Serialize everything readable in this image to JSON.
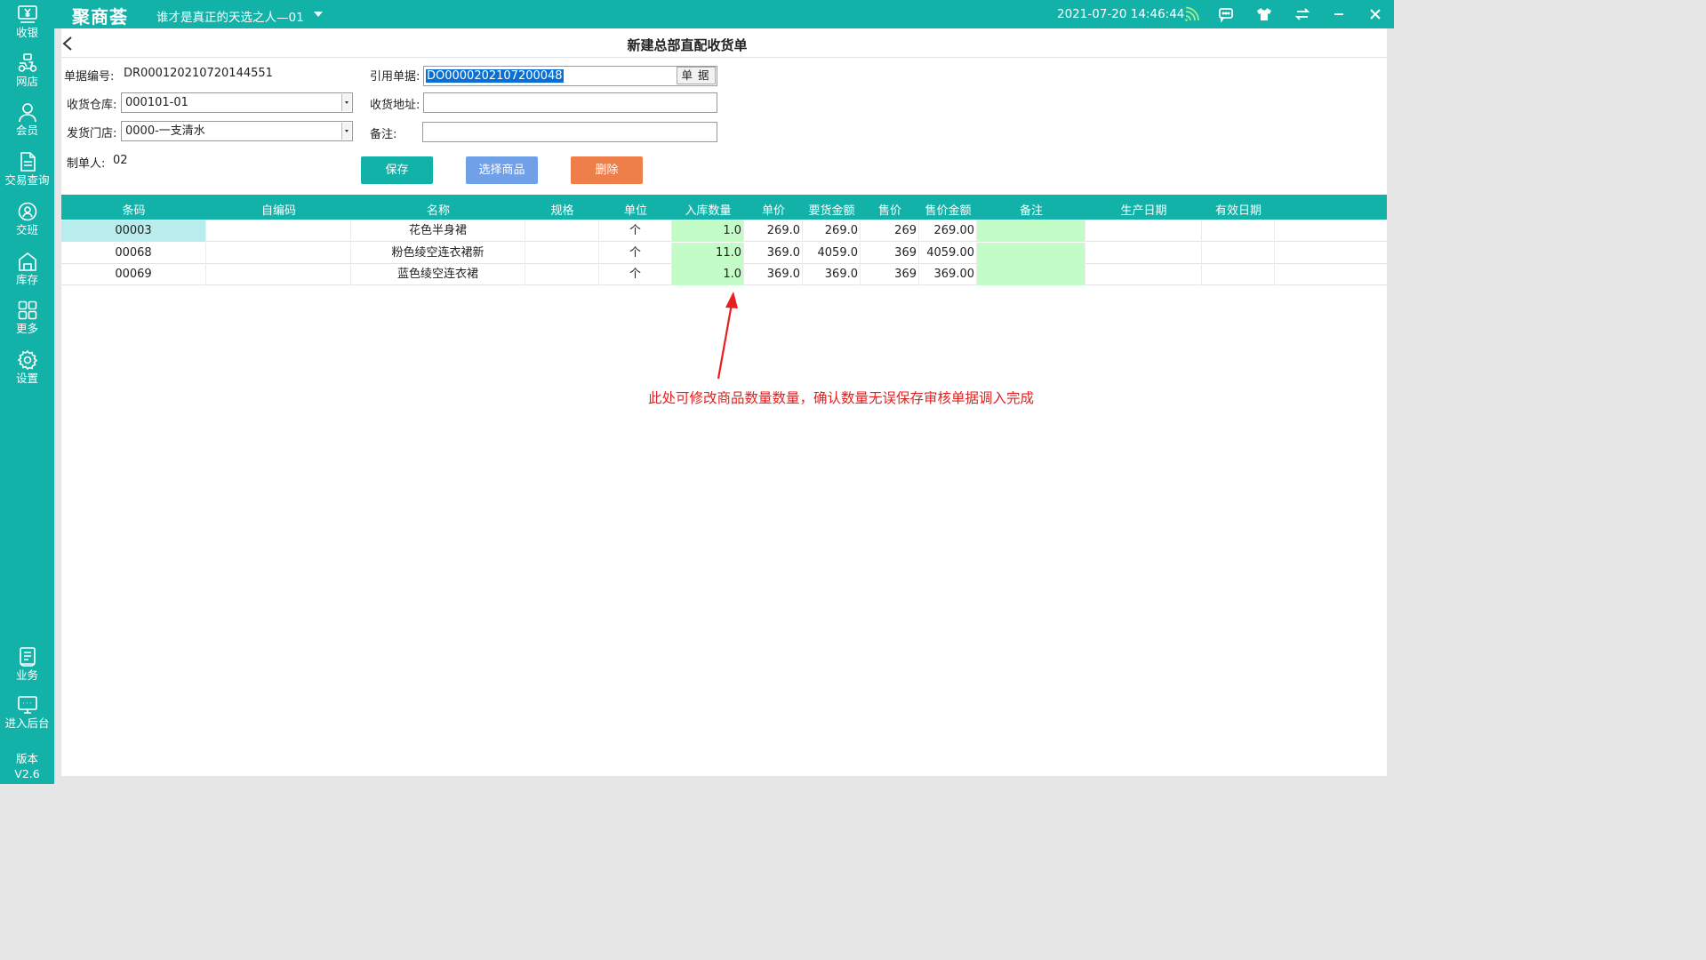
{
  "sidebar": {
    "items": [
      {
        "label": "收银",
        "icon": "cash-register-icon"
      },
      {
        "label": "网店",
        "icon": "delivery-scooter-icon"
      },
      {
        "label": "会员",
        "icon": "member-icon"
      },
      {
        "label": "交易查询",
        "icon": "transaction-query-icon"
      },
      {
        "label": "交班",
        "icon": "shift-handover-icon"
      },
      {
        "label": "库存",
        "icon": "inventory-icon"
      },
      {
        "label": "更多",
        "icon": "more-grid-icon"
      },
      {
        "label": "设置",
        "icon": "settings-gear-icon"
      },
      {
        "label": "业务",
        "icon": "business-icon"
      },
      {
        "label": "进入后台",
        "icon": "backend-monitor-icon"
      }
    ],
    "version_label": "版本",
    "version_value": "V2.6"
  },
  "topbar": {
    "logo": "聚商荟",
    "store_name": "谁才是真正的天选之人—01",
    "datetime": "2021-07-20 14:46:44",
    "accent_color": "#13b2a8"
  },
  "page": {
    "title": "新建总部直配收货单"
  },
  "form": {
    "doc_no_label": "单据编号:",
    "doc_no_value": "DR000120210720144551",
    "ref_doc_label": "引用单据:",
    "ref_doc_value": "DO0000202107200048",
    "ref_doc_button": "单据",
    "warehouse_label": "收货仓库:",
    "warehouse_value": "000101-01",
    "address_label": "收货地址:",
    "address_value": "",
    "ship_store_label": "发货门店:",
    "ship_store_value": "0000-一支清水",
    "remark_label": "备注:",
    "remark_value": "",
    "creator_label": "制单人:",
    "creator_value": "02"
  },
  "actions": {
    "save": "保存",
    "select_goods": "选择商品",
    "delete": "删除",
    "save_color": "#13b2a8",
    "select_color": "#6fa0e8",
    "delete_color": "#ee7f4a"
  },
  "table": {
    "headers": [
      "条码",
      "自编码",
      "名称",
      "规格",
      "单位",
      "入库数量",
      "单价",
      "要货金额",
      "售价",
      "售价金额",
      "备注",
      "生产日期",
      "有效日期"
    ],
    "rows": [
      {
        "barcode": "00003",
        "selfcode": "",
        "name": "花色半身裙",
        "spec": "",
        "unit": "个",
        "qty": "1.0",
        "price": "269.0",
        "req_amount": "269.0",
        "sale_price": "269",
        "sale_amount": "269.00",
        "remark": "",
        "mfg_date": "",
        "exp_date": ""
      },
      {
        "barcode": "00068",
        "selfcode": "",
        "name": "粉色绫空连衣裙新",
        "spec": "",
        "unit": "个",
        "qty": "11.0",
        "price": "369.0",
        "req_amount": "4059.0",
        "sale_price": "369",
        "sale_amount": "4059.00",
        "remark": "",
        "mfg_date": "",
        "exp_date": ""
      },
      {
        "barcode": "00069",
        "selfcode": "",
        "name": "蓝色绫空连衣裙",
        "spec": "",
        "unit": "个",
        "qty": "1.0",
        "price": "369.0",
        "req_amount": "369.0",
        "sale_price": "369",
        "sale_amount": "369.00",
        "remark": "",
        "mfg_date": "",
        "exp_date": ""
      }
    ]
  },
  "annotation": {
    "text": "此处可修改商品数量数量，确认数量无误保存审核单据调入完成",
    "color": "#e62020"
  }
}
